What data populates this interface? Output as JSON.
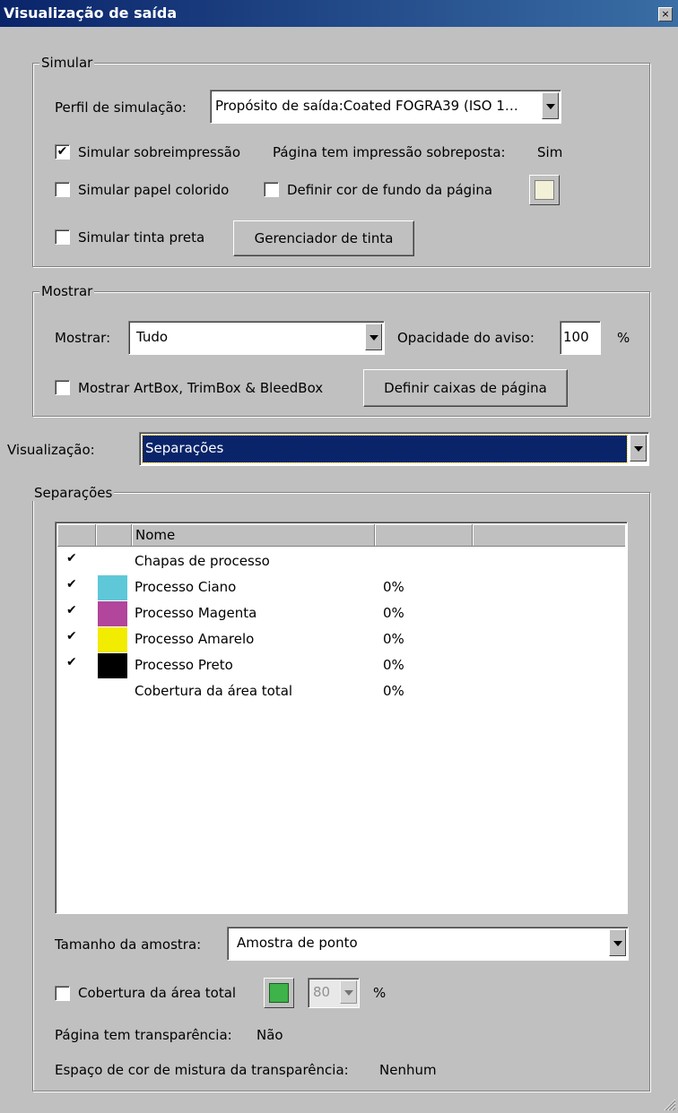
{
  "window": {
    "title": "Visualização de saída",
    "close_label": "×"
  },
  "simular": {
    "legend": "Simular",
    "perfil_label": "Perfil de simulação:",
    "perfil_value": "Propósito de saída:Coated FOGRA39 (ISO 1…",
    "sobreimpressao_label": "Simular sobreimpressão",
    "sobreimpressao_checked": "✔",
    "sobreposta_label": "Página tem impressão sobreposta:",
    "sobreposta_value": "Sim",
    "papel_label": "Simular papel colorido",
    "cor_fundo_label": "Definir cor de fundo da página",
    "tinta_preta_label": "Simular tinta preta",
    "gerenciador_button": "Gerenciador de tinta",
    "bg_color": "#f3f0d8"
  },
  "mostrar": {
    "legend": "Mostrar",
    "mostrar_label": "Mostrar:",
    "mostrar_value": "Tudo",
    "opacidade_label": "Opacidade do aviso:",
    "opacidade_value": "100",
    "percent": "%",
    "boxes_label": "Mostrar ArtBox, TrimBox & BleedBox",
    "definir_caixas_button": "Definir caixas de página"
  },
  "visualizacao": {
    "label": "Visualização:",
    "value": "Separações"
  },
  "separacoes": {
    "legend": "Separações",
    "column_name": "Nome",
    "rows": [
      {
        "checked": "✔",
        "color": "",
        "name": "Chapas de processo",
        "value": ""
      },
      {
        "checked": "✔",
        "color": "#5ec8d8",
        "name": "Processo Ciano",
        "value": "0%"
      },
      {
        "checked": "✔",
        "color": "#b2459c",
        "name": "Processo Magenta",
        "value": "0%"
      },
      {
        "checked": "✔",
        "color": "#f2ec00",
        "name": "Processo Amarelo",
        "value": "0%"
      },
      {
        "checked": "✔",
        "color": "#000000",
        "name": "Processo Preto",
        "value": "0%"
      },
      {
        "checked": "",
        "color": "",
        "name": "Cobertura da área total",
        "value": "0%"
      }
    ],
    "amostra_label": "Tamanho da amostra:",
    "amostra_value": "Amostra de ponto",
    "cobertura_label": "Cobertura da área total",
    "cobertura_color": "#3db34a",
    "cobertura_value": "80",
    "percent": "%",
    "transparencia_label": "Página tem transparência:",
    "transparencia_value": "Não",
    "espaco_label": "Espaço de cor de mistura da transparência:",
    "espaco_value": "Nenhum"
  }
}
